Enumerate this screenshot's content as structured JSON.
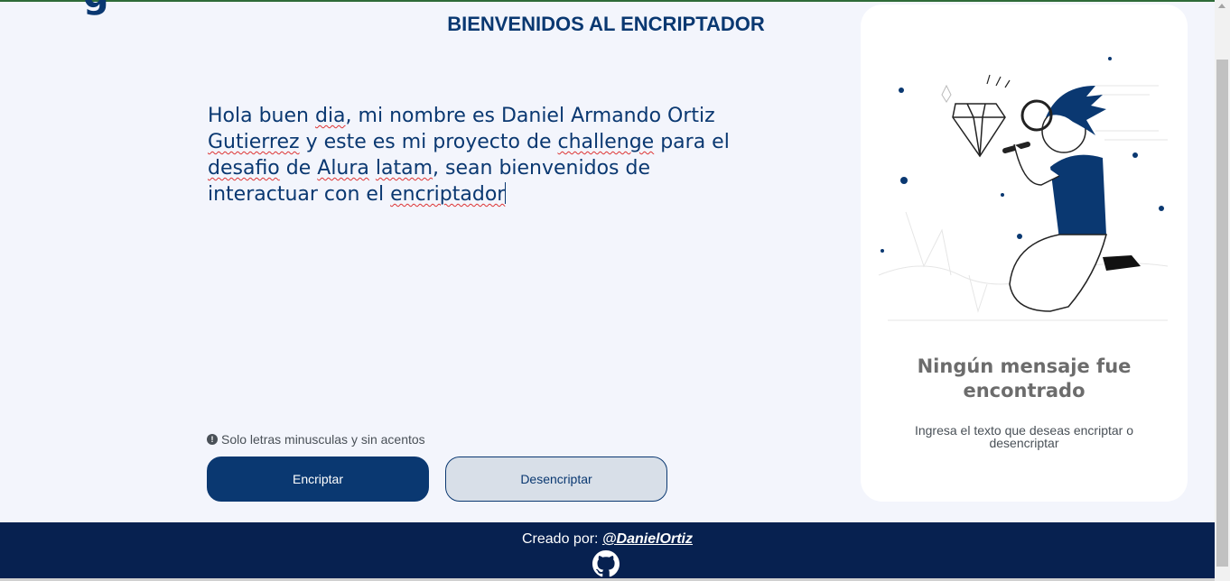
{
  "logo_fragment": "g",
  "page_title": "BIENVENIDOS AL ENCRIPTADOR",
  "input": {
    "words": [
      "Hola ",
      "buen ",
      {
        "w": "dia",
        "spell": true
      },
      ", mi nombre es Daniel Armando Ortiz ",
      {
        "w": "Gutierrez",
        "spell": true
      },
      " y este es mi proyecto de ",
      {
        "w": "challenge",
        "spell": true
      },
      " para el ",
      {
        "w": "desafio",
        "spell": true
      },
      " de ",
      {
        "w": "Alura",
        "spell": true
      },
      " ",
      {
        "w": "latam",
        "spell": true
      },
      ", sean bienvenidos de interactuar con el ",
      {
        "w": "encriptador",
        "spell": true
      }
    ]
  },
  "hint": {
    "icon": "info-icon",
    "text": "Solo letras minusculas y sin acentos"
  },
  "buttons": {
    "encrypt": "Encriptar",
    "decrypt": "Desencriptar"
  },
  "output": {
    "title": "Ningún mensaje fue encontrado",
    "subtitle": "Ingresa el texto que deseas encriptar o desencriptar",
    "illustration": "person-with-magnifying-glass-illustration"
  },
  "footer": {
    "credit_prefix": "Creado por: ",
    "credit_link": "@DanielOrtiz",
    "icon": "github-icon"
  },
  "colors": {
    "primary": "#0a3871",
    "footer": "#072150",
    "background": "#f3f5fc",
    "panel": "#ffffff"
  }
}
